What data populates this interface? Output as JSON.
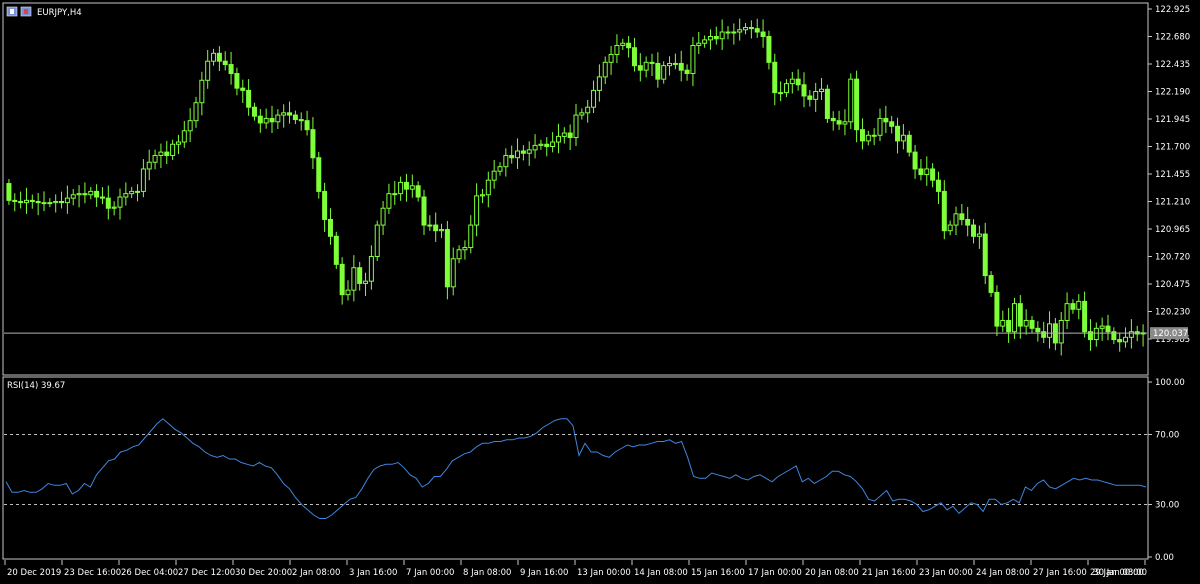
{
  "header": {
    "symbol_label": "EURJPY,H4",
    "indicator_label": "RSI(14) 39.67"
  },
  "colors": {
    "background": "#000000",
    "frame": "#c8c8c8",
    "candle": "#7fff3a",
    "rsi_line": "#3f86e0",
    "bid_line": "#b4b4b4",
    "price_tag_bg": "#8a8a8a",
    "levels": "#bfbfbf"
  },
  "price_axis": {
    "ticks": [
      "122.925",
      "122.680",
      "122.435",
      "122.190",
      "121.945",
      "121.700",
      "121.455",
      "121.210",
      "120.965",
      "120.720",
      "120.475",
      "120.230",
      "119.985"
    ]
  },
  "current_price": {
    "value": 120.037,
    "label": "120.037"
  },
  "rsi_axis": {
    "ticks": [
      "100.00",
      "70.00",
      "30.00",
      "0.00"
    ],
    "levels": [
      70,
      30
    ]
  },
  "time_axis": {
    "labels": [
      "20 Dec 2019",
      "23 Dec 16:00",
      "26 Dec 04:00",
      "27 Dec 12:00",
      "30 Dec 20:00",
      "2 Jan 08:00",
      "3 Jan 16:00",
      "7 Jan 00:00",
      "8 Jan 08:00",
      "9 Jan 16:00",
      "13 Jan 00:00",
      "14 Jan 08:00",
      "15 Jan 16:00",
      "17 Jan 00:00",
      "20 Jan 08:00",
      "21 Jan 16:00",
      "23 Jan 00:00",
      "24 Jan 08:00",
      "27 Jan 16:00",
      "29 Jan 00:00",
      "30 Jan 08:00"
    ]
  },
  "chart_data": [
    {
      "type": "candlestick",
      "symbol": "EURJPY",
      "timeframe": "H4",
      "ylim": [
        119.98,
        122.94
      ],
      "close": [
        121.22,
        121.21,
        121.2,
        121.22,
        121.21,
        121.2,
        121.2,
        121.2,
        121.21,
        121.2,
        121.24,
        121.27,
        121.28,
        121.27,
        121.3,
        121.25,
        121.24,
        121.15,
        121.16,
        121.25,
        121.28,
        121.3,
        121.3,
        121.5,
        121.56,
        121.62,
        121.65,
        121.62,
        121.72,
        121.74,
        121.84,
        121.93,
        122.09,
        122.29,
        122.46,
        122.53,
        122.46,
        122.43,
        122.35,
        122.22,
        122.2,
        122.05,
        121.97,
        121.91,
        121.95,
        121.92,
        121.98,
        122.0,
        121.98,
        121.94,
        121.93,
        121.85,
        121.6,
        121.3,
        121.05,
        120.9,
        120.65,
        120.38,
        120.42,
        120.62,
        120.48,
        120.5,
        120.72,
        121.0,
        121.15,
        121.28,
        121.28,
        121.38,
        121.32,
        121.35,
        121.25,
        121.0,
        121.0,
        120.95,
        120.96,
        120.45,
        120.7,
        120.78,
        120.8,
        121.0,
        121.26,
        121.27,
        121.4,
        121.48,
        121.52,
        121.62,
        121.6,
        121.66,
        121.64,
        121.67,
        121.71,
        121.72,
        121.7,
        121.74,
        121.79,
        121.82,
        121.78,
        121.98,
        122.0,
        122.05,
        122.2,
        122.32,
        122.45,
        122.52,
        122.6,
        122.62,
        122.58,
        122.42,
        122.38,
        122.45,
        122.44,
        122.3,
        122.42,
        122.44,
        122.44,
        122.38,
        122.35,
        122.6,
        122.62,
        122.65,
        122.68,
        122.66,
        122.72,
        122.72,
        122.72,
        122.74,
        122.76,
        122.75,
        122.72,
        122.68,
        122.45,
        122.18,
        122.18,
        122.26,
        122.3,
        122.25,
        122.15,
        122.12,
        122.19,
        122.21,
        121.95,
        121.93,
        121.9,
        121.92,
        122.3,
        121.85,
        121.75,
        121.8,
        121.8,
        121.95,
        121.92,
        121.88,
        121.75,
        121.8,
        121.65,
        121.5,
        121.45,
        121.5,
        121.4,
        121.3,
        120.95,
        121.0,
        121.1,
        121.05,
        121.0,
        120.9,
        120.92,
        120.55,
        120.4,
        120.1,
        120.15,
        120.05,
        120.3,
        120.1,
        120.15,
        120.08,
        120.05,
        120.0,
        120.12,
        119.95,
        120.15,
        120.3,
        120.25,
        120.32,
        120.05,
        119.98,
        120.08,
        120.1,
        120.05,
        119.98,
        119.96,
        120.0,
        120.05,
        120.03,
        120.04
      ]
    },
    {
      "type": "line",
      "name": "RSI(14)",
      "ylim": [
        0,
        100
      ],
      "levels": [
        30,
        70
      ],
      "values": [
        43,
        37,
        37,
        38,
        37,
        37,
        39,
        42,
        41,
        41,
        42,
        36,
        38,
        42,
        40,
        47,
        51,
        55,
        56,
        60,
        61,
        63,
        64,
        68,
        72,
        76,
        79,
        76,
        73,
        71,
        68,
        65,
        63,
        60,
        58,
        57,
        58,
        56,
        56,
        54,
        53,
        52,
        54,
        52,
        51,
        47,
        42,
        39,
        34,
        30,
        27,
        24,
        22,
        22,
        24,
        27,
        30,
        33,
        34,
        39,
        45,
        50,
        52,
        53,
        53,
        54,
        51,
        47,
        45,
        40,
        42,
        46,
        46,
        50,
        55,
        57,
        59,
        60,
        63,
        65,
        65,
        66,
        66,
        67,
        67,
        68,
        68,
        69,
        71,
        74,
        76,
        78,
        79,
        79,
        75,
        58,
        65,
        60,
        60,
        58,
        57,
        60,
        62,
        64,
        63,
        64,
        64,
        65,
        66,
        66,
        67,
        65,
        66,
        57,
        46,
        45,
        45,
        48,
        47,
        46,
        45,
        47,
        45,
        44,
        46,
        47,
        45,
        43,
        46,
        48,
        50,
        52,
        43,
        45,
        42,
        44,
        46,
        49,
        49,
        47,
        46,
        43,
        39,
        33,
        32,
        35,
        38,
        32,
        33,
        33,
        32,
        30,
        26,
        27,
        29,
        31,
        27,
        29,
        25,
        28,
        31,
        30,
        26,
        33,
        33,
        30,
        31,
        33,
        31,
        40,
        38,
        42,
        44,
        40,
        39,
        41,
        43,
        45,
        44,
        45,
        44,
        44,
        43,
        42,
        41,
        41,
        41,
        41,
        41,
        40
      ]
    }
  ]
}
